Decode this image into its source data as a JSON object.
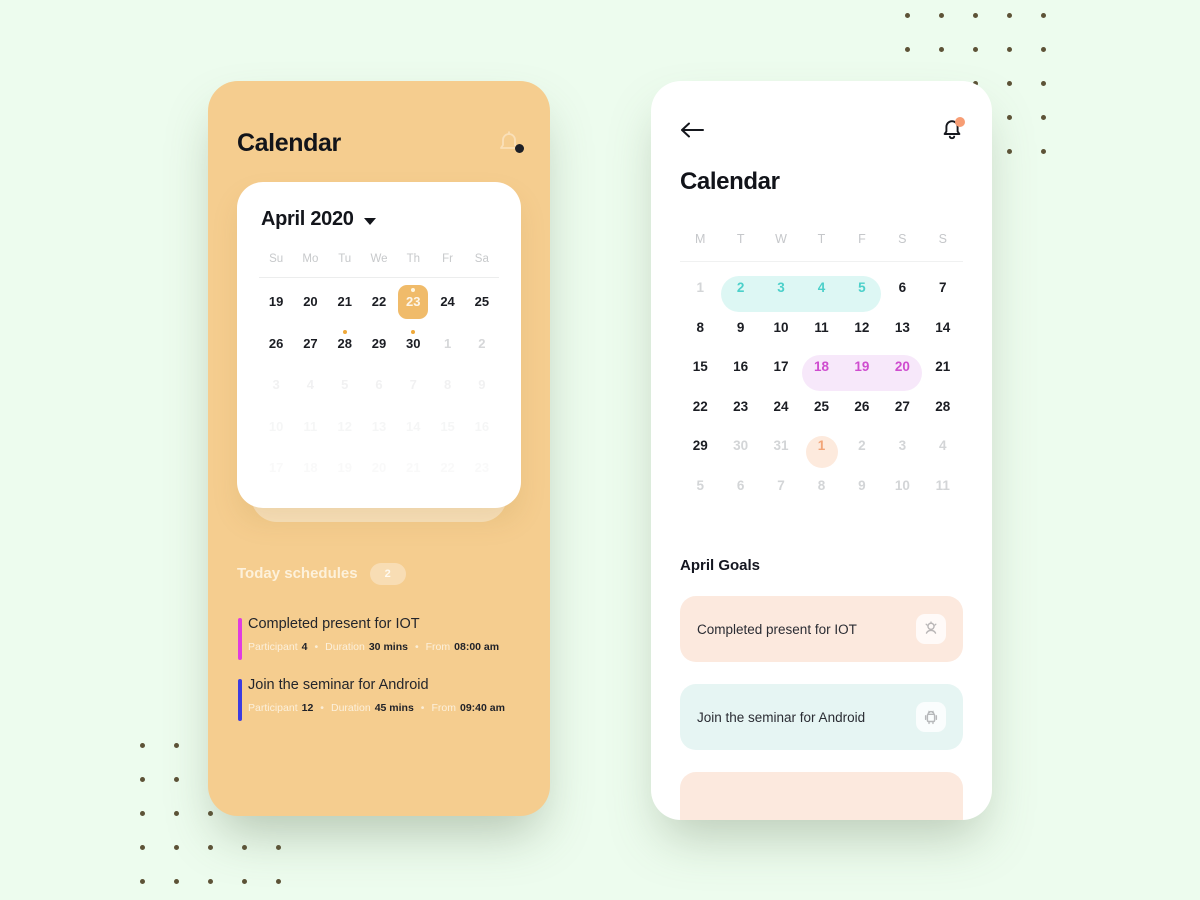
{
  "canvas": {
    "background": "#edfcee",
    "dot_color": "#5d5337"
  },
  "left_phone": {
    "background": "#f5cd8f",
    "header": {
      "title": "Calendar",
      "bell_icon": "bell-icon",
      "notification_dot": true
    },
    "calendar_card": {
      "month_label": "April 2020",
      "dropdown_icon": "chevron-down-icon",
      "weekdays": [
        "Su",
        "Mo",
        "Tu",
        "We",
        "Th",
        "Fr",
        "Sa"
      ],
      "selected_day": "23",
      "accent": "#f0bb6a",
      "event_dot_color": "#efa93a",
      "weeks": [
        {
          "fade": "none",
          "days": [
            {
              "n": "19",
              "state": "current",
              "dot": false
            },
            {
              "n": "20",
              "state": "current",
              "dot": false
            },
            {
              "n": "21",
              "state": "current",
              "dot": false
            },
            {
              "n": "22",
              "state": "current",
              "dot": false
            },
            {
              "n": "23",
              "state": "selected",
              "dot": true
            },
            {
              "n": "24",
              "state": "current",
              "dot": false
            },
            {
              "n": "25",
              "state": "current",
              "dot": false
            }
          ]
        },
        {
          "fade": "none",
          "days": [
            {
              "n": "26",
              "state": "current",
              "dot": false
            },
            {
              "n": "27",
              "state": "current",
              "dot": false
            },
            {
              "n": "28",
              "state": "current",
              "dot": true
            },
            {
              "n": "29",
              "state": "current",
              "dot": false
            },
            {
              "n": "30",
              "state": "current",
              "dot": true
            },
            {
              "n": "1",
              "state": "outside",
              "dot": false
            },
            {
              "n": "2",
              "state": "outside",
              "dot": false
            }
          ]
        },
        {
          "fade": "f1",
          "days": [
            {
              "n": "3",
              "state": "outside",
              "dot": false
            },
            {
              "n": "4",
              "state": "outside",
              "dot": false
            },
            {
              "n": "5",
              "state": "outside",
              "dot": false
            },
            {
              "n": "6",
              "state": "outside",
              "dot": false
            },
            {
              "n": "7",
              "state": "outside",
              "dot": false
            },
            {
              "n": "8",
              "state": "outside",
              "dot": false
            },
            {
              "n": "9",
              "state": "outside",
              "dot": false
            }
          ]
        },
        {
          "fade": "f2",
          "days": [
            {
              "n": "10",
              "state": "outside",
              "dot": false
            },
            {
              "n": "11",
              "state": "outside",
              "dot": false
            },
            {
              "n": "12",
              "state": "outside",
              "dot": false
            },
            {
              "n": "13",
              "state": "outside",
              "dot": false
            },
            {
              "n": "14",
              "state": "outside",
              "dot": false
            },
            {
              "n": "15",
              "state": "outside",
              "dot": false
            },
            {
              "n": "16",
              "state": "outside",
              "dot": false
            }
          ]
        },
        {
          "fade": "f3",
          "days": [
            {
              "n": "17",
              "state": "outside",
              "dot": false
            },
            {
              "n": "18",
              "state": "outside",
              "dot": false
            },
            {
              "n": "19",
              "state": "outside",
              "dot": false
            },
            {
              "n": "20",
              "state": "outside",
              "dot": false
            },
            {
              "n": "21",
              "state": "outside",
              "dot": false
            },
            {
              "n": "22",
              "state": "outside",
              "dot": false
            },
            {
              "n": "23",
              "state": "outside",
              "dot": false
            }
          ]
        }
      ]
    },
    "schedules": {
      "title": "Today schedules",
      "count_badge": "2",
      "items": [
        {
          "name": "Completed present for IOT",
          "bar_color": "#e03ce0",
          "participant_label": "Participant",
          "participant_value": "4",
          "duration_label": "Duration",
          "duration_value": "30 mins",
          "from_label": "From",
          "from_value": "08:00 am"
        },
        {
          "name": "Join the seminar for Android",
          "bar_color": "#3c3ce0",
          "participant_label": "Participant",
          "participant_value": "12",
          "duration_label": "Duration",
          "duration_value": "45 mins",
          "from_label": "From",
          "from_value": "09:40 am"
        }
      ],
      "separator": "•"
    }
  },
  "right_phone": {
    "background": "#ffffff",
    "header": {
      "back_icon": "arrow-left-icon",
      "bell_icon": "bell-icon",
      "notification_dot_color": "#f79d74"
    },
    "title": "Calendar",
    "calendar": {
      "weekdays": [
        "M",
        "T",
        "W",
        "T",
        "F",
        "S",
        "S"
      ],
      "highlights": [
        {
          "type": "range",
          "color": "#ddf7f4",
          "text_color": "#4bd0ca",
          "days": [
            "2",
            "3",
            "4",
            "5"
          ]
        },
        {
          "type": "range",
          "color": "#f7e8fa",
          "text_color": "#cf4ccf",
          "days": [
            "18",
            "19",
            "20"
          ]
        },
        {
          "type": "circle",
          "color": "#fdeadd",
          "text_color": "#f2a477",
          "days": [
            "1"
          ]
        }
      ],
      "weeks": [
        [
          {
            "n": "1",
            "state": "muted"
          },
          {
            "n": "2",
            "state": "teal"
          },
          {
            "n": "3",
            "state": "teal"
          },
          {
            "n": "4",
            "state": "teal"
          },
          {
            "n": "5",
            "state": "teal"
          },
          {
            "n": "6",
            "state": "normal"
          },
          {
            "n": "7",
            "state": "normal"
          }
        ],
        [
          {
            "n": "8",
            "state": "normal"
          },
          {
            "n": "9",
            "state": "normal"
          },
          {
            "n": "10",
            "state": "normal"
          },
          {
            "n": "11",
            "state": "normal"
          },
          {
            "n": "12",
            "state": "normal"
          },
          {
            "n": "13",
            "state": "normal"
          },
          {
            "n": "14",
            "state": "normal"
          }
        ],
        [
          {
            "n": "15",
            "state": "normal"
          },
          {
            "n": "16",
            "state": "normal"
          },
          {
            "n": "17",
            "state": "normal"
          },
          {
            "n": "18",
            "state": "violet"
          },
          {
            "n": "19",
            "state": "violet"
          },
          {
            "n": "20",
            "state": "violet"
          },
          {
            "n": "21",
            "state": "normal"
          }
        ],
        [
          {
            "n": "22",
            "state": "normal"
          },
          {
            "n": "23",
            "state": "normal"
          },
          {
            "n": "24",
            "state": "normal"
          },
          {
            "n": "25",
            "state": "normal"
          },
          {
            "n": "26",
            "state": "normal"
          },
          {
            "n": "27",
            "state": "normal"
          },
          {
            "n": "28",
            "state": "normal"
          }
        ],
        [
          {
            "n": "29",
            "state": "normal"
          },
          {
            "n": "30",
            "state": "muted"
          },
          {
            "n": "31",
            "state": "muted"
          },
          {
            "n": "1",
            "state": "peach"
          },
          {
            "n": "2",
            "state": "muted"
          },
          {
            "n": "3",
            "state": "muted"
          },
          {
            "n": "4",
            "state": "muted"
          }
        ],
        [
          {
            "n": "5",
            "state": "muted"
          },
          {
            "n": "6",
            "state": "muted"
          },
          {
            "n": "7",
            "state": "muted"
          },
          {
            "n": "8",
            "state": "muted"
          },
          {
            "n": "9",
            "state": "muted"
          },
          {
            "n": "10",
            "state": "muted"
          },
          {
            "n": "11",
            "state": "muted"
          }
        ]
      ]
    },
    "goals": {
      "title": "April Goals",
      "items": [
        {
          "label": "Completed present for IOT",
          "theme": "peach",
          "icon": "iot-chip-icon"
        },
        {
          "label": "Join the seminar for Android",
          "theme": "mint",
          "icon": "android-robot-icon"
        },
        {
          "label": "",
          "theme": "peach",
          "icon": ""
        }
      ]
    }
  }
}
